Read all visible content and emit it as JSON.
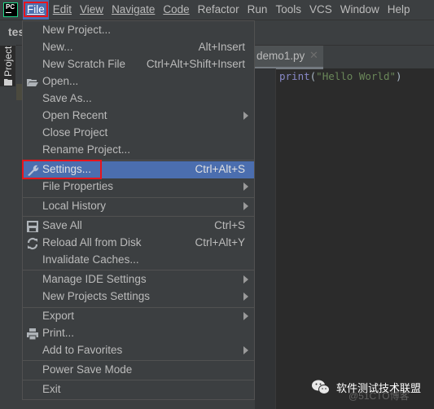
{
  "app": {
    "logo_text": "PC"
  },
  "menubar": {
    "items": [
      {
        "label": "File",
        "mnemonic_index": 0,
        "active": true
      },
      {
        "label": "Edit",
        "mnemonic_index": 0
      },
      {
        "label": "View",
        "mnemonic_index": 0
      },
      {
        "label": "Navigate",
        "mnemonic_index": 0
      },
      {
        "label": "Code",
        "mnemonic_index": 0
      },
      {
        "label": "Refactor",
        "mnemonic_index": 0
      },
      {
        "label": "Run",
        "mnemonic_index": 1
      },
      {
        "label": "Tools",
        "mnemonic_index": 0
      },
      {
        "label": "VCS",
        "mnemonic_index": 2
      },
      {
        "label": "Window",
        "mnemonic_index": 0
      },
      {
        "label": "Help",
        "mnemonic_index": 0
      }
    ]
  },
  "toolbar": {
    "project_name_partial": "tes"
  },
  "tool_window": {
    "project_tab_label": "Project"
  },
  "editor": {
    "tab_name": "demo1.py",
    "code": {
      "keyword": "print",
      "open": "(",
      "string": "\"Hello World\"",
      "close": ")"
    }
  },
  "file_menu": {
    "items": [
      {
        "label": "New Project..."
      },
      {
        "label": "New...",
        "shortcut": "Alt+Insert"
      },
      {
        "label": "New Scratch File",
        "shortcut": "Ctrl+Alt+Shift+Insert"
      },
      {
        "label": "Open...",
        "icon": "folder-open-icon"
      },
      {
        "label": "Save As..."
      },
      {
        "label": "Open Recent",
        "submenu": true
      },
      {
        "label": "Close Project"
      },
      {
        "label": "Rename Project..."
      },
      {
        "label": "Settings...",
        "shortcut": "Ctrl+Alt+S",
        "icon": "wrench-icon",
        "selected": true
      },
      {
        "label": "File Properties",
        "submenu": true
      },
      {
        "label": "Local History",
        "submenu": true
      },
      {
        "label": "Save All",
        "shortcut": "Ctrl+S",
        "icon": "save-icon"
      },
      {
        "label": "Reload All from Disk",
        "shortcut": "Ctrl+Alt+Y",
        "icon": "reload-icon"
      },
      {
        "label": "Invalidate Caches..."
      },
      {
        "label": "Manage IDE Settings",
        "submenu": true
      },
      {
        "label": "New Projects Settings",
        "submenu": true
      },
      {
        "label": "Export",
        "submenu": true
      },
      {
        "label": "Print...",
        "icon": "print-icon"
      },
      {
        "label": "Add to Favorites",
        "submenu": true
      },
      {
        "label": "Power Save Mode"
      },
      {
        "label": "Exit"
      }
    ]
  },
  "watermark": {
    "text": "软件测试技术联盟",
    "sub_text": "@51CTO博客"
  },
  "colors": {
    "accent": "#4b6eaf",
    "highlight_box": "#e8141b",
    "menu_bg": "#3c3f41",
    "editor_bg": "#2b2b2b"
  }
}
